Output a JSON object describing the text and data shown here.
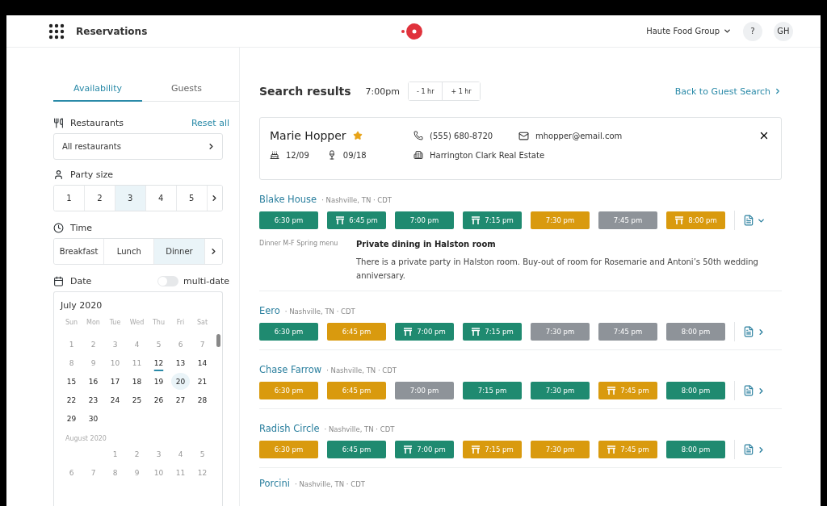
{
  "header": {
    "title": "Reservations",
    "org": "Haute Food Group",
    "help": "?",
    "avatar": "GH"
  },
  "sidebar": {
    "tabs": [
      {
        "label": "Availability",
        "selected": true
      },
      {
        "label": "Guests",
        "selected": false
      }
    ],
    "restaurants": {
      "label": "Restaurants",
      "reset": "Reset all",
      "value": "All restaurants"
    },
    "party": {
      "label": "Party size",
      "options": [
        {
          "label": "1",
          "selected": false
        },
        {
          "label": "2",
          "selected": false
        },
        {
          "label": "3",
          "selected": true
        },
        {
          "label": "4",
          "selected": false
        },
        {
          "label": "5",
          "selected": false
        }
      ]
    },
    "time": {
      "label": "Time",
      "options": [
        {
          "label": "Breakfast",
          "selected": false
        },
        {
          "label": "Lunch",
          "selected": false
        },
        {
          "label": "Dinner",
          "selected": true
        }
      ]
    },
    "date": {
      "label": "Date",
      "toggle_label": "multi-date",
      "multi_date": false
    },
    "calendar": {
      "weekdays": [
        "Sun",
        "Mon",
        "Tue",
        "Wed",
        "Thu",
        "Fri",
        "Sat"
      ],
      "months": [
        {
          "title": "July 2020",
          "days": [
            {
              "label": "1",
              "disabled": true,
              "today": false,
              "selected": false
            },
            {
              "label": "2",
              "disabled": true,
              "today": false,
              "selected": false
            },
            {
              "label": "3",
              "disabled": true,
              "today": false,
              "selected": false
            },
            {
              "label": "4",
              "disabled": true,
              "today": false,
              "selected": false
            },
            {
              "label": "5",
              "disabled": true,
              "today": false,
              "selected": false
            },
            {
              "label": "6",
              "disabled": true,
              "today": false,
              "selected": false
            },
            {
              "label": "7",
              "disabled": true,
              "today": false,
              "selected": false
            },
            {
              "label": "8",
              "disabled": true,
              "today": false,
              "selected": false
            },
            {
              "label": "9",
              "disabled": true,
              "today": false,
              "selected": false
            },
            {
              "label": "10",
              "disabled": true,
              "today": false,
              "selected": false
            },
            {
              "label": "11",
              "disabled": true,
              "today": false,
              "selected": false
            },
            {
              "label": "12",
              "disabled": false,
              "today": true,
              "selected": false
            },
            {
              "label": "13",
              "disabled": false,
              "today": false,
              "selected": false
            },
            {
              "label": "14",
              "disabled": false,
              "today": false,
              "selected": false
            },
            {
              "label": "15",
              "disabled": false,
              "today": false,
              "selected": false
            },
            {
              "label": "16",
              "disabled": false,
              "today": false,
              "selected": false
            },
            {
              "label": "17",
              "disabled": false,
              "today": false,
              "selected": false
            },
            {
              "label": "18",
              "disabled": false,
              "today": false,
              "selected": false
            },
            {
              "label": "19",
              "disabled": false,
              "today": false,
              "selected": false
            },
            {
              "label": "20",
              "disabled": false,
              "today": false,
              "selected": true
            },
            {
              "label": "21",
              "disabled": false,
              "today": false,
              "selected": false
            },
            {
              "label": "22",
              "disabled": false,
              "today": false,
              "selected": false
            },
            {
              "label": "23",
              "disabled": false,
              "today": false,
              "selected": false
            },
            {
              "label": "24",
              "disabled": false,
              "today": false,
              "selected": false
            },
            {
              "label": "25",
              "disabled": false,
              "today": false,
              "selected": false
            },
            {
              "label": "26",
              "disabled": false,
              "today": false,
              "selected": false
            },
            {
              "label": "27",
              "disabled": false,
              "today": false,
              "selected": false
            },
            {
              "label": "28",
              "disabled": false,
              "today": false,
              "selected": false
            },
            {
              "label": "29",
              "disabled": false,
              "today": false,
              "selected": false
            },
            {
              "label": "30",
              "disabled": false,
              "today": false,
              "selected": false
            }
          ]
        },
        {
          "title": "August 2020",
          "days": [
            {
              "label": "1",
              "disabled": true,
              "today": false,
              "selected": false
            },
            {
              "label": "2",
              "disabled": true,
              "today": false,
              "selected": false
            },
            {
              "label": "3",
              "disabled": true,
              "today": false,
              "selected": false
            },
            {
              "label": "4",
              "disabled": true,
              "today": false,
              "selected": false
            },
            {
              "label": "5",
              "disabled": true,
              "today": false,
              "selected": false
            },
            {
              "label": "6",
              "disabled": true,
              "today": false,
              "selected": false
            },
            {
              "label": "7",
              "disabled": true,
              "today": false,
              "selected": false
            },
            {
              "label": "8",
              "disabled": true,
              "today": false,
              "selected": false
            },
            {
              "label": "9",
              "disabled": true,
              "today": false,
              "selected": false
            },
            {
              "label": "10",
              "disabled": true,
              "today": false,
              "selected": false
            },
            {
              "label": "11",
              "disabled": true,
              "today": false,
              "selected": false
            },
            {
              "label": "12",
              "disabled": true,
              "today": false,
              "selected": false
            }
          ]
        }
      ]
    }
  },
  "results": {
    "title": "Search results",
    "time": "7:00pm",
    "shift_buttons": [
      "- 1 hr",
      "+ 1 hr"
    ],
    "back_link": "Back to Guest Search",
    "guest": {
      "name": "Marie Hopper",
      "favorite": true,
      "phone": "(555) 680-8720",
      "email": "mhopper@email.com",
      "birthday": "12/09",
      "anniversary": "09/18",
      "company": "Harrington Clark Real Estate"
    },
    "restaurants": [
      {
        "name": "Blake House",
        "location": "· Nashville, TN · CDT",
        "expanded": true,
        "slots": [
          {
            "time": "6:30 pm",
            "color": "#1f8a70",
            "table": false
          },
          {
            "time": "6:45 pm",
            "color": "#1f8a70",
            "table": true
          },
          {
            "time": "7:00 pm",
            "color": "#1f8a70",
            "table": false
          },
          {
            "time": "7:15 pm",
            "color": "#1f8a70",
            "table": true
          },
          {
            "time": "7:30 pm",
            "color": "#d99a0e",
            "table": false
          },
          {
            "time": "7:45 pm",
            "color": "#8e9399",
            "table": false
          },
          {
            "time": "8:00 pm",
            "color": "#d99a0e",
            "table": true
          }
        ],
        "menu": "Dinner M-F Spring menu",
        "note_title": "Private dining in Halston room",
        "note": "There is a private party in Halston room. Buy-out of room for Rosemarie and Antoni’s 50th wedding anniversary."
      },
      {
        "name": "Eero",
        "location": "· Nashville, TN · CDT",
        "expanded": false,
        "slots": [
          {
            "time": "6:30 pm",
            "color": "#1f8a70",
            "table": false
          },
          {
            "time": "6:45 pm",
            "color": "#d99a0e",
            "table": false
          },
          {
            "time": "7:00 pm",
            "color": "#1f8a70",
            "table": true
          },
          {
            "time": "7:15 pm",
            "color": "#1f8a70",
            "table": true
          },
          {
            "time": "7:30 pm",
            "color": "#8e9399",
            "table": false
          },
          {
            "time": "7:45 pm",
            "color": "#8e9399",
            "table": false
          },
          {
            "time": "8:00 pm",
            "color": "#8e9399",
            "table": false
          }
        ]
      },
      {
        "name": "Chase Farrow",
        "location": "· Nashville, TN · CDT",
        "expanded": false,
        "slots": [
          {
            "time": "6:30 pm",
            "color": "#d99a0e",
            "table": false
          },
          {
            "time": "6:45 pm",
            "color": "#d99a0e",
            "table": false
          },
          {
            "time": "7:00 pm",
            "color": "#8e9399",
            "table": false
          },
          {
            "time": "7:15 pm",
            "color": "#1f8a70",
            "table": false
          },
          {
            "time": "7:30 pm",
            "color": "#1f8a70",
            "table": false
          },
          {
            "time": "7:45 pm",
            "color": "#d99a0e",
            "table": true
          },
          {
            "time": "8:00 pm",
            "color": "#1f8a70",
            "table": false
          }
        ]
      },
      {
        "name": "Radish Circle",
        "location": "· Nashville, TN · CDT",
        "expanded": false,
        "slots": [
          {
            "time": "6:30 pm",
            "color": "#d99a0e",
            "table": false
          },
          {
            "time": "6:45 pm",
            "color": "#1f8a70",
            "table": false
          },
          {
            "time": "7:00 pm",
            "color": "#1f8a70",
            "table": true
          },
          {
            "time": "7:15 pm",
            "color": "#d99a0e",
            "table": true
          },
          {
            "time": "7:30 pm",
            "color": "#d99a0e",
            "table": false
          },
          {
            "time": "7:45 pm",
            "color": "#d99a0e",
            "table": true
          },
          {
            "time": "8:00 pm",
            "color": "#1f8a70",
            "table": false
          }
        ]
      },
      {
        "name": "Porcini",
        "location": "· Nashville, TN · CDT"
      }
    ]
  }
}
